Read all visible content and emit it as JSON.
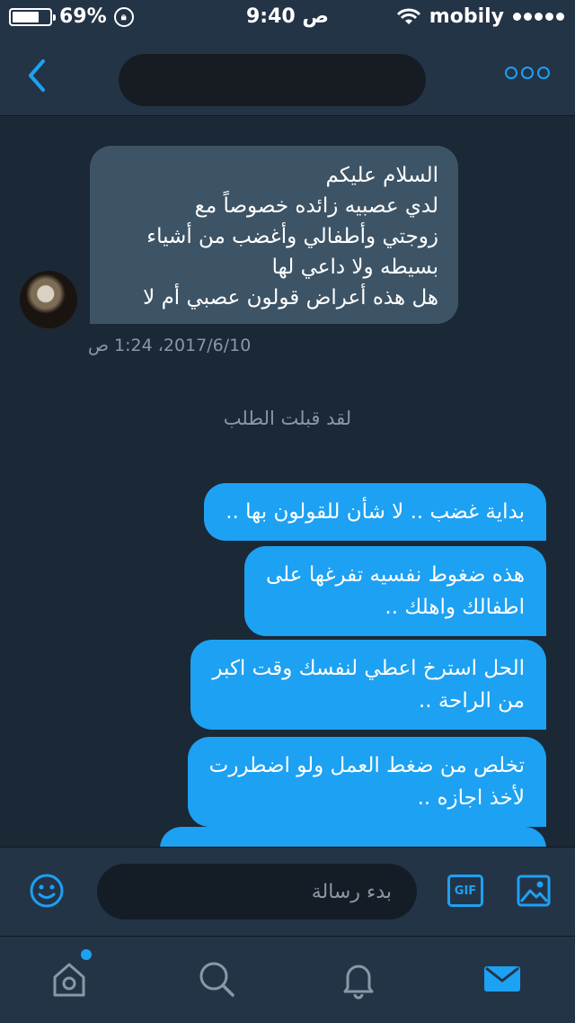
{
  "status_bar": {
    "battery": "69%",
    "battery_level": 0.69,
    "time": "9:40 ص",
    "carrier": "mobily",
    "signal_icon": "wifi-icon"
  },
  "nav": {
    "back_icon": "chevron-left-icon",
    "more_icon": "more-icon"
  },
  "conversation": {
    "incoming": {
      "lines": [
        "السلام عليكم",
        "لدي عصبيه زائده خصوصاً مع",
        "زوجتي وأطفالي وأغضب من أشياء",
        "بسيطه ولا داعي لها",
        "هل هذه أعراض قولون عصبي أم لا"
      ],
      "timestamp": "2017/6/10، 1:24 ص"
    },
    "accepted_text": "لقد قبلت الطلب",
    "outgoing": [
      {
        "lines": [
          "بداية غضب .. لا شأن للقولون بها .."
        ]
      },
      {
        "lines": [
          "هذه ضغوط نفسيه تفرغها على",
          "اطفالك واهلك .."
        ]
      },
      {
        "lines": [
          "الحل استرخ اعطي لنفسك وقت اكبر",
          "من الراحة .."
        ]
      },
      {
        "lines": [
          "تخلص من ضغط العمل ولو اضطررت",
          "لأخذ اجازه .."
        ]
      }
    ]
  },
  "composer": {
    "placeholder": "بدء رسالة",
    "gif_label": "GIF"
  },
  "colors": {
    "accent": "#1da1f2",
    "incoming_bubble": "#3d5466",
    "background": "#1b2836",
    "bars": "#243447",
    "muted_text": "#8899a6"
  }
}
